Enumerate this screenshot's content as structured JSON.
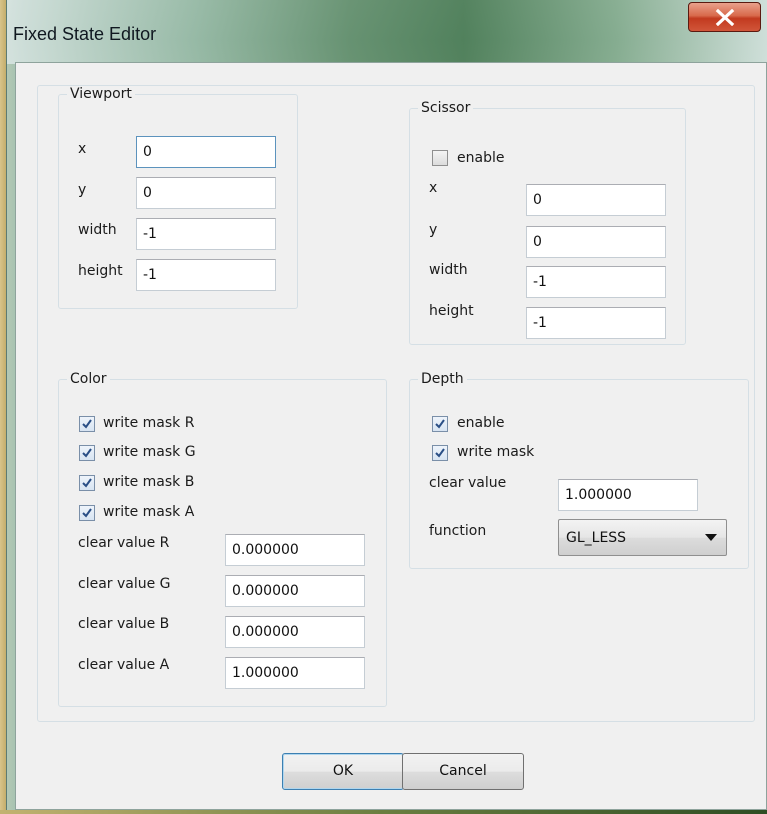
{
  "window": {
    "title": "Fixed State Editor",
    "close_label": "X"
  },
  "viewport": {
    "legend": "Viewport",
    "x_label": "x",
    "x_value": "0",
    "y_label": "y",
    "y_value": "0",
    "width_label": "width",
    "width_value": "-1",
    "height_label": "height",
    "height_value": "-1"
  },
  "scissor": {
    "legend": "Scissor",
    "enable_label": "enable",
    "enable_checked": false,
    "x_label": "x",
    "x_value": "0",
    "y_label": "y",
    "y_value": "0",
    "width_label": "width",
    "width_value": "-1",
    "height_label": "height",
    "height_value": "-1"
  },
  "color": {
    "legend": "Color",
    "write_mask_r_label": "write mask R",
    "write_mask_g_label": "write mask G",
    "write_mask_b_label": "write mask B",
    "write_mask_a_label": "write mask A",
    "write_masks_checked": [
      true,
      true,
      true,
      true
    ],
    "clear_r_label": "clear value R",
    "clear_r_value": "0.000000",
    "clear_g_label": "clear value G",
    "clear_g_value": "0.000000",
    "clear_b_label": "clear value B",
    "clear_b_value": "0.000000",
    "clear_a_label": "clear value A",
    "clear_a_value": "1.000000"
  },
  "depth": {
    "legend": "Depth",
    "enable_label": "enable",
    "enable_checked": true,
    "write_mask_label": "write mask",
    "write_mask_checked": true,
    "clear_label": "clear value",
    "clear_value": "1.000000",
    "function_label": "function",
    "function_value": "GL_LESS"
  },
  "buttons": {
    "ok_label": "OK",
    "cancel_label": "Cancel"
  },
  "colors": {
    "focus_border": "#5c93bd",
    "close_button": "#c23a1f",
    "dialog_background": "#f0f0f0"
  }
}
